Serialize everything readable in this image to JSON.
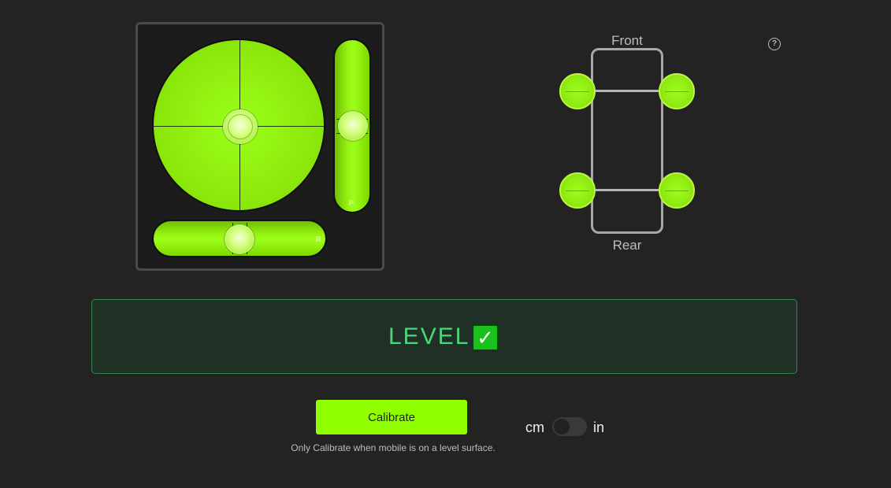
{
  "level_widget": {
    "pitch_label": "P",
    "roll_label": "R",
    "bubble_color": "#9cff1a"
  },
  "car": {
    "front_label": "Front",
    "rear_label": "Rear",
    "wheel_color": "#9cff1a"
  },
  "help": {
    "icon": "help-icon",
    "glyph": "?"
  },
  "status": {
    "text": "LEVEL",
    "check_glyph": "✓",
    "color": "#4bd67a"
  },
  "calibrate": {
    "label": "Calibrate",
    "note": "Only Calibrate when mobile is on a level surface.",
    "color": "#90ff00"
  },
  "units": {
    "left": "cm",
    "right": "in",
    "selected": "cm"
  }
}
